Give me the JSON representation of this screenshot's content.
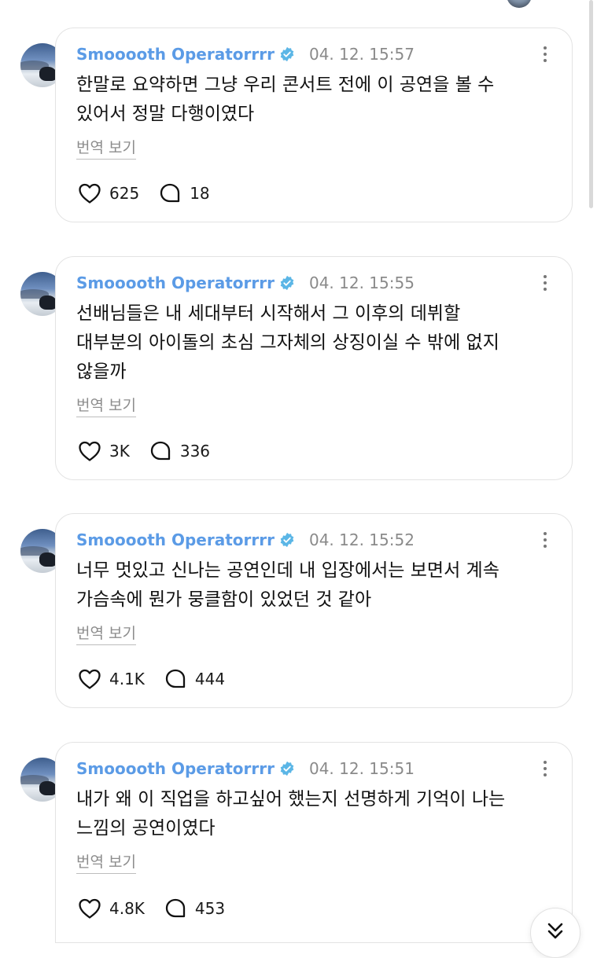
{
  "posts": [
    {
      "username": "Smooooth Operatorrrr",
      "timestamp": "04. 12. 15:57",
      "lines": [
        "한말로 요약하면 그냥 우리 콘서트 전에 이 공연을 볼 수",
        "있어서 정말 다행이였다"
      ],
      "translate_label": "번역 보기",
      "likes": "625",
      "replies": "18"
    },
    {
      "username": "Smooooth Operatorrrr",
      "timestamp": "04. 12. 15:55",
      "lines": [
        "선배님들은 내 세대부터 시작해서 그 이후의 데뷔할",
        "대부분의 아이돌의 초심 그자체의 상징이실 수 밖에 없지",
        "않을까"
      ],
      "translate_label": "번역 보기",
      "likes": "3K",
      "replies": "336"
    },
    {
      "username": "Smooooth Operatorrrr",
      "timestamp": "04. 12. 15:52",
      "lines": [
        "너무 멋있고 신나는 공연인데 내 입장에서는 보면서 계속",
        "가슴속에 뭔가 뭉클함이 있었던 것 같아"
      ],
      "translate_label": "번역 보기",
      "likes": "4.1K",
      "replies": "444"
    },
    {
      "username": "Smooooth Operatorrrr",
      "timestamp": "04. 12. 15:51",
      "lines": [
        "내가 왜 이 직업을 하고싶어 했는지 선명하게 기억이 나는",
        "느낌의 공연이였다"
      ],
      "translate_label": "번역 보기",
      "likes": "4.8K",
      "replies": "453"
    }
  ],
  "colors": {
    "username": "#5b9be6",
    "verified_badge": "#5bb6e6",
    "timestamp": "#8a8a8a",
    "card_border": "#e3e3e3"
  },
  "icons": {
    "like": "heart-icon",
    "reply": "reply-bubble-icon",
    "more": "more-vertical-icon",
    "verified": "verified-badge-icon",
    "scroll": "double-chevron-down-icon"
  }
}
